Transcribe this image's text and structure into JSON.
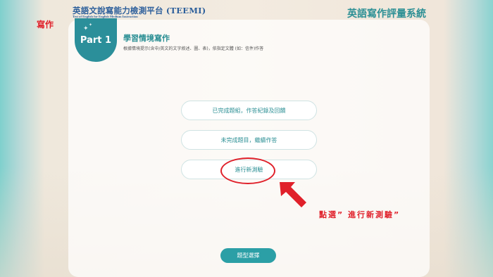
{
  "header": {
    "app_title": "英語文說寫能力檢測平台 (TEEMI)",
    "app_subtitle": "Test of English for English Medium Instruction",
    "system_title": "英語寫作評量系統"
  },
  "section_label": "寫作",
  "part_badge": "Part 1",
  "task": {
    "title": "學習情境寫作",
    "description": "根據情境提示(含中/英文的文字敘述、圖、表)，依指定文體 (如：信件)作答"
  },
  "options": [
    {
      "label": "已完成題組，作答紀錄及回饋"
    },
    {
      "label": "未完成題目，繼續作答"
    },
    {
      "label": "進行新測驗"
    }
  ],
  "annotation": "點選” 進行新測驗”",
  "type_select_button": "題型選擇",
  "colors": {
    "accent": "#2b8f94",
    "highlight": "#e0202a"
  }
}
